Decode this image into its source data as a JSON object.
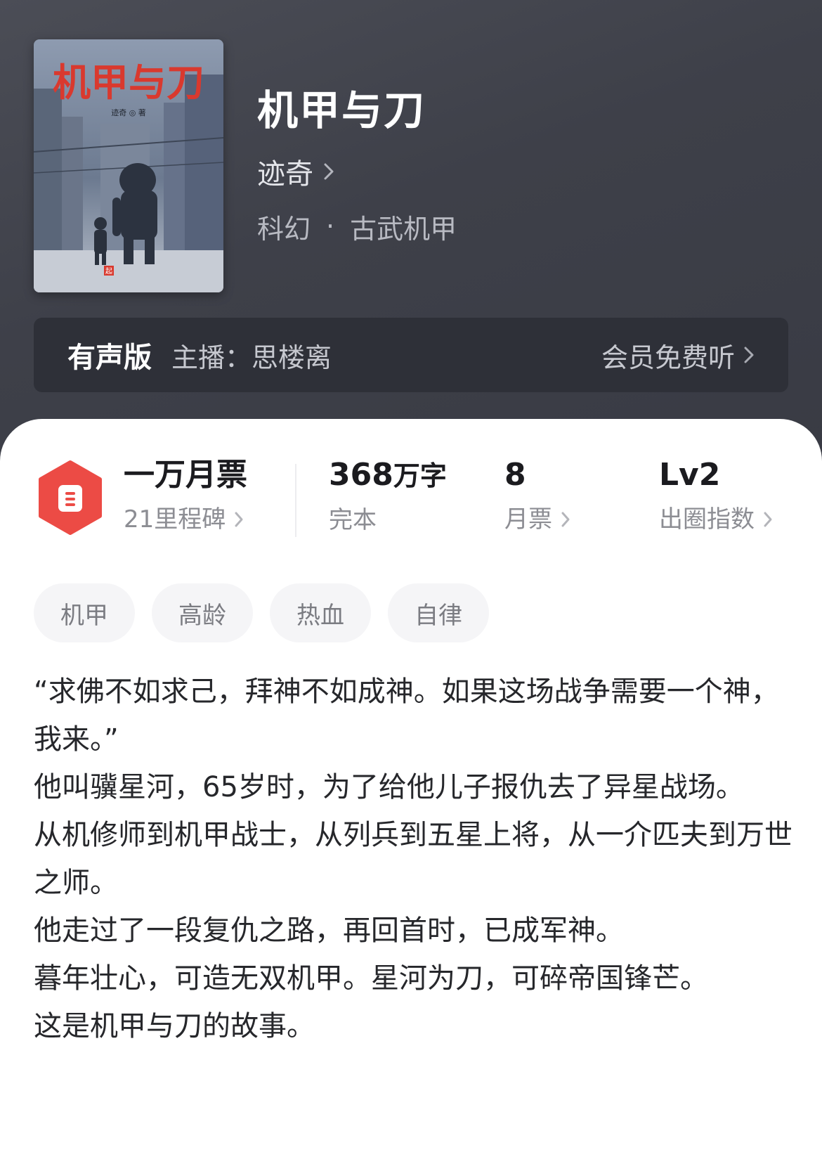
{
  "book": {
    "title": "机甲与刀",
    "author": "迹奇",
    "genre_main": "科幻",
    "genre_separator": "·",
    "genre_sub": "古武机甲",
    "cover": {
      "title_text": "机甲与刀",
      "author_text": "迹奇 ◎ 著",
      "badge_text": "起",
      "title_color": "#d9392e"
    }
  },
  "audio": {
    "tag": "有声版",
    "narrator": "主播：思楼离",
    "free_label": "会员免费听"
  },
  "stats": {
    "ticket": {
      "title": "一万月票",
      "sub": "21里程碑"
    },
    "words": {
      "value": "368",
      "unit": "万字",
      "sub": "完本"
    },
    "monthly": {
      "value": "8",
      "sub": "月票"
    },
    "level": {
      "value": "Lv2",
      "sub": "出圈指数"
    }
  },
  "tags": [
    "机甲",
    "高龄",
    "热血",
    "自律"
  ],
  "synopsis": [
    "“求佛不如求己，拜神不如成神。如果这场战争需要一个神，我来。”",
    "他叫骥星河，65岁时，为了给他儿子报仇去了异星战场。",
    "从机修师到机甲战士，从列兵到五星上将，从一介匹夫到万世之师。",
    "他走过了一段复仇之路，再回首时，已成军神。",
    "暮年壮心，可造无双机甲。星河为刀，可碎帝国锋芒。",
    "这是机甲与刀的故事。"
  ],
  "colors": {
    "hero_bg": "#3e4049",
    "audio_bar_bg": "#2e3038",
    "ticket_icon": "#ec4b45",
    "chip_bg": "#f5f5f7"
  },
  "icons": {
    "author_chevron": "chevron-right-icon",
    "audio_chevron": "chevron-right-icon",
    "ticket": "ticket-hexagon-icon"
  }
}
